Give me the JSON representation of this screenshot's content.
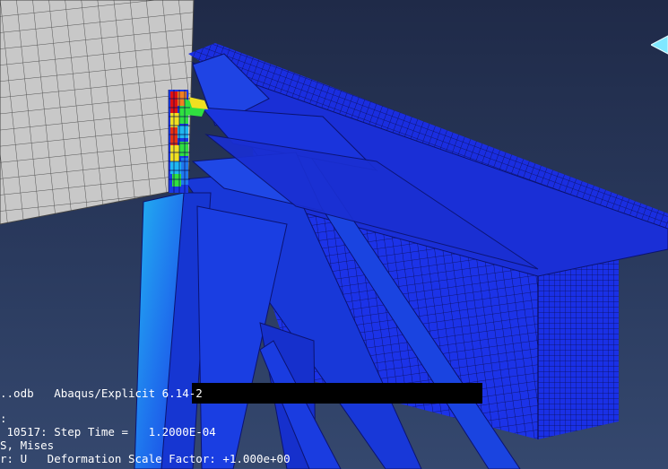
{
  "colors": {
    "background_top": "#1f2a48",
    "background_bottom": "#35486e",
    "mesh_blue": "#1a2ee0",
    "mesh_line": "#0a0e55",
    "plate_gray": "#c8c8c8",
    "contour_red": "#e01010",
    "contour_yellow": "#f0e020",
    "contour_green": "#30e040",
    "contour_cyan": "#20b8f0",
    "triad_cyan": "#7fe8ff"
  },
  "info": {
    "line1_file": "..odb",
    "line1_solver": "Abaqus/Explicit 6.14-2",
    "line2": ":",
    "line3": " 10517: Step Time =   1.2000E-04",
    "line4": "S, Mises",
    "line5": "r: U   Deformation Scale Factor: +1.000e+00"
  },
  "icons": {
    "triad": "view-triad-arrow-icon",
    "redaction": "redacted-info-bar"
  }
}
